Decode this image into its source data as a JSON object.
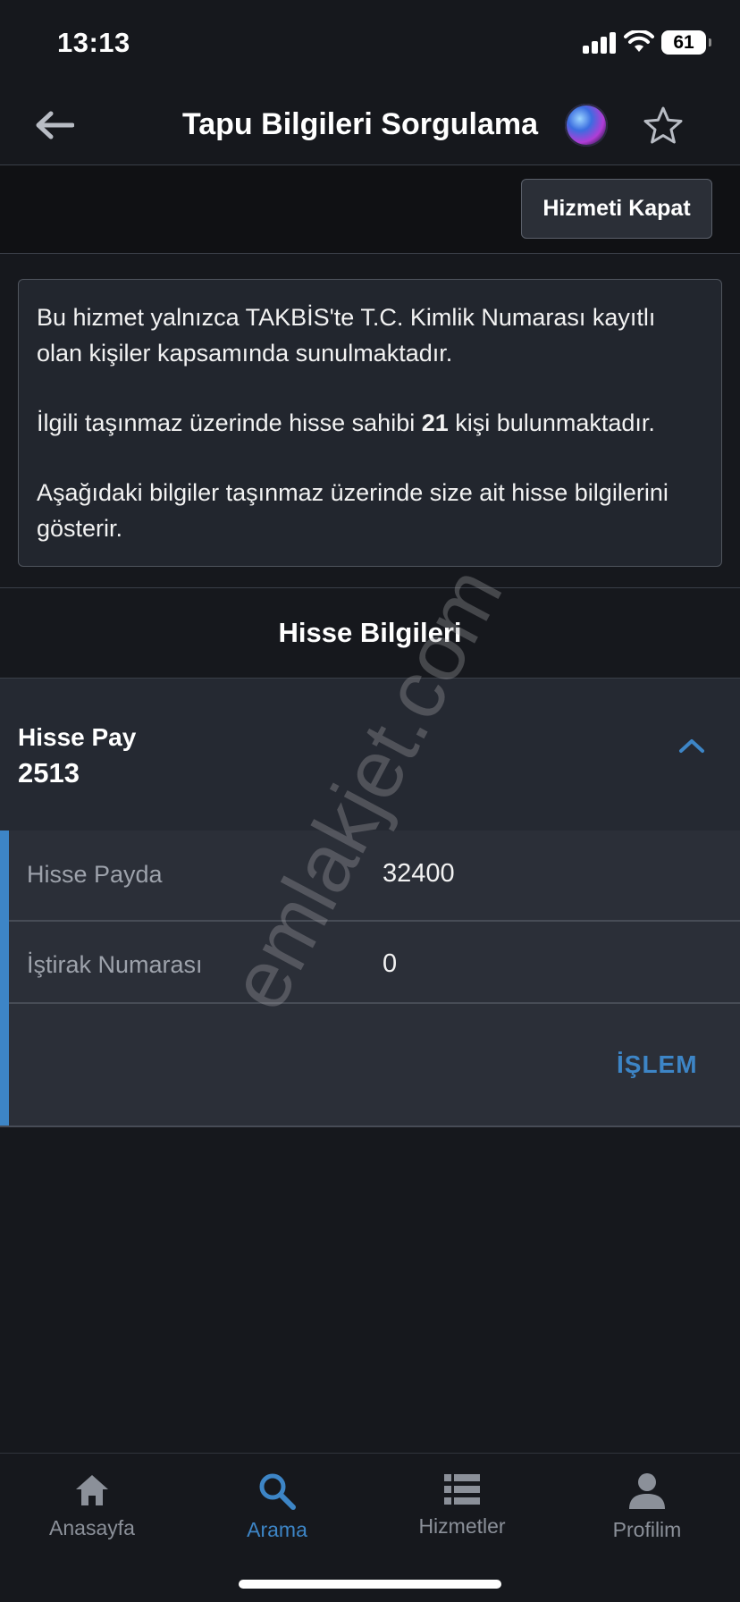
{
  "status_bar": {
    "time": "13:13",
    "battery": "61"
  },
  "header": {
    "title": "Tapu Bilgileri Sorgulama",
    "back_icon": "arrow-left-icon",
    "favorite_icon": "star-icon"
  },
  "service_bar": {
    "close_label": "Hizmeti Kapat"
  },
  "info": {
    "paragraph1": "Bu hizmet yalnızca TAKBİS'te T.C. Kimlik Numarası kayıtlı olan kişiler kapsamında sunulmaktadır.",
    "paragraph2_prefix": "İlgili taşınmaz üzerinde hisse sahibi ",
    "paragraph2_count": "21",
    "paragraph2_suffix": " kişi bulunmaktadır.",
    "paragraph3": "Aşağıdaki bilgiler taşınmaz üzerinde size ait hisse bilgilerini gösterir."
  },
  "section": {
    "title": "Hisse Bilgileri"
  },
  "share": {
    "pay_label": "Hisse Pay",
    "pay_value": "2513",
    "rows": [
      {
        "label": "Hisse Payda",
        "value": "32400"
      },
      {
        "label": "İştirak Numarası",
        "value": "0"
      }
    ],
    "action_label": "İŞLEM"
  },
  "watermark": "emlakjet.com",
  "tabs": [
    {
      "label": "Anasayfa",
      "icon": "home-icon",
      "active": false
    },
    {
      "label": "Arama",
      "icon": "search-icon",
      "active": true
    },
    {
      "label": "Hizmetler",
      "icon": "list-icon",
      "active": false
    },
    {
      "label": "Profilim",
      "icon": "user-icon",
      "active": false
    }
  ],
  "colors": {
    "accent": "#3d85c6",
    "background": "#16181d",
    "card": "#22262e"
  }
}
